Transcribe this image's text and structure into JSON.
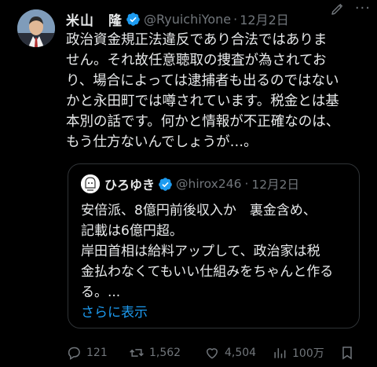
{
  "tweet": {
    "author_name": "米山　隆",
    "handle": "@RyuichiYone",
    "separator": "·",
    "date": "12月2日",
    "more_label": "···",
    "lines": [
      "政治資金規正法違反であり合法ではありま",
      "せん。それ故任意聴取の捜査が為されてお",
      "り、場合によっては逮捕者も出るのではない",
      "かと永田町では噂されています。税金とは基",
      "本別の話です。何かと情報が不正確なのは、",
      "もう仕方ないんでしょうが…。"
    ]
  },
  "quoted": {
    "author_name": "ひろゆき",
    "handle": "@hirox246",
    "separator": "·",
    "date": "12月2日",
    "lines": [
      "安倍派、8億円前後収入か　裏金含め、",
      "記載は6億円超。",
      "岸田首相は給料アップして、政治家は税",
      "金払わなくてもいい仕組みをちゃんと作る",
      "る。..."
    ],
    "show_more": "さらに表示"
  },
  "actions": {
    "replies": "121",
    "reposts": "1,562",
    "likes": "4,504",
    "views": "100万"
  },
  "colors": {
    "background": "#000000",
    "text": "#e7e9ea",
    "secondary": "#71767b",
    "link": "#1d9bf0",
    "verified": "#1d9bf0"
  }
}
